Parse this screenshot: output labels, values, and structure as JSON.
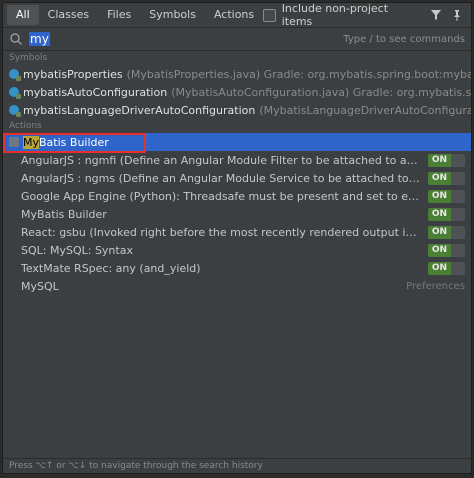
{
  "tabs": [
    {
      "label": "All",
      "active": true
    },
    {
      "label": "Classes",
      "active": false
    },
    {
      "label": "Files",
      "active": false
    },
    {
      "label": "Symbols",
      "active": false
    },
    {
      "label": "Actions",
      "active": false
    }
  ],
  "include_non_project": {
    "label": "Include non-project items",
    "checked": false
  },
  "icons": {
    "filter": "filter-icon",
    "pin": "pin-icon",
    "search": "search-icon"
  },
  "search": {
    "value": "my",
    "hint": "Type / to see commands"
  },
  "sections": {
    "symbols": "Symbols",
    "actions": "Actions"
  },
  "symbols": [
    {
      "name": "mybatisProperties",
      "detail": "(MybatisProperties.java)  Gradle: org.mybatis.spring.boot:mybatis-spring-boot..."
    },
    {
      "name": "mybatisAutoConfiguration",
      "detail": "(MybatisAutoConfiguration.java)  Gradle: org.mybatis.spring.boot:my..."
    },
    {
      "name": "mybatisLanguageDriverAutoConfiguration",
      "detail": "(MybatisLanguageDriverAutoConfiguration.java)  Gradle..."
    }
  ],
  "actions": [
    {
      "match": "My",
      "rest": "Batis Builder",
      "selected": true,
      "toggle": null
    },
    {
      "label": "AngularJS : ngmfi (Define an Angular Module Filter to be attached to a previously defined m...",
      "toggle": "ON"
    },
    {
      "label": "AngularJS : ngms (Define an Angular Module Service to be attached to a previously defined...",
      "toggle": "ON"
    },
    {
      "label": "Google App Engine (Python): Threadsafe must be present and set to either 'yes' or 'no'",
      "toggle": "ON"
    },
    {
      "label": "MyBatis Builder",
      "toggle": "ON"
    },
    {
      "label": "React: gsbu (Invoked right before the most recently rendered output is committed to e.g. t...",
      "toggle": "ON"
    },
    {
      "label": "SQL: MySQL: Syntax",
      "toggle": "ON"
    },
    {
      "label": "TextMate RSpec: any (and_yield)",
      "toggle": "ON"
    },
    {
      "label": "MySQL",
      "pref": "Preferences"
    }
  ],
  "footer": "Press ⌥↑ or ⌥↓ to navigate through the search history",
  "colors": {
    "selection": "#2f65ca",
    "toggle_on": "#4a7f35",
    "highlight_box": "#e8302a"
  }
}
